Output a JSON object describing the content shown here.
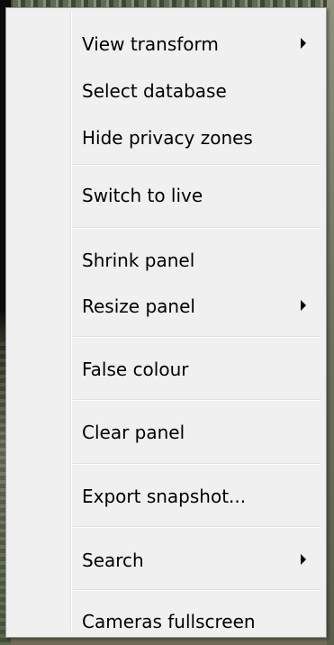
{
  "menu": {
    "items": [
      {
        "label": "View transform",
        "submenu": true
      },
      {
        "label": "Select database",
        "submenu": false
      },
      {
        "label": "Hide privacy zones",
        "submenu": false
      },
      {
        "label": "Switch to live",
        "submenu": false
      },
      {
        "label": "Shrink panel",
        "submenu": false
      },
      {
        "label": "Resize panel",
        "submenu": true
      },
      {
        "label": "False colour",
        "submenu": false
      },
      {
        "label": "Clear panel",
        "submenu": false
      },
      {
        "label": "Export snapshot...",
        "submenu": false
      },
      {
        "label": "Search",
        "submenu": true
      },
      {
        "label": "Cameras fullscreen",
        "submenu": false
      }
    ]
  }
}
